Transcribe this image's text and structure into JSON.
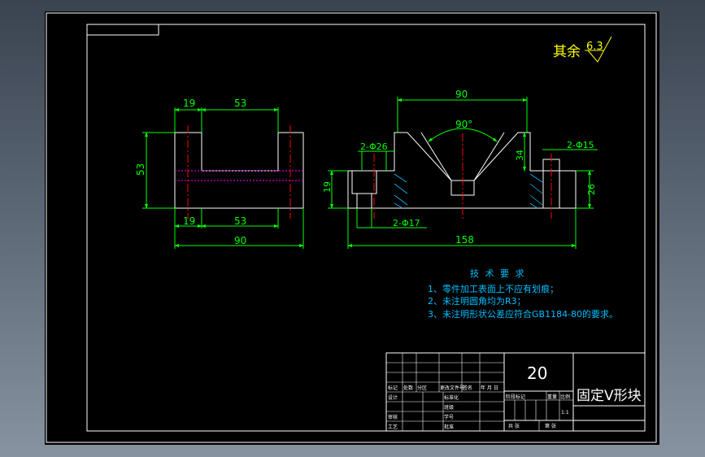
{
  "roughness": {
    "label": "其余",
    "value": "6.3"
  },
  "front_view": {
    "dim_top_left": "19",
    "dim_top_right": "53",
    "dim_height": "53",
    "dim_bottom_left": "19",
    "dim_bottom_right": "53",
    "dim_total": "90"
  },
  "side_view": {
    "dim_top": "90",
    "dim_angle": "90°",
    "dim_hole_left": "2-Φ26",
    "dim_hole_right": "2-Φ15",
    "dim_depth": "34",
    "dim_height_left": "19",
    "dim_height_right": "26",
    "dim_hole_bottom": "2-Φ17",
    "dim_total": "158"
  },
  "tech_requirements": {
    "title": "技 术 要 求",
    "items": [
      "1、零件加工表面上不应有划痕；",
      "2、未注明圆角均为R3；",
      "3、未注明形状公差应符合GB1184-80的要求。"
    ]
  },
  "title_block": {
    "drawing_no": "20",
    "part_name": "固定V形块",
    "scale": "1:1",
    "rows": {
      "mark": "标记",
      "count": "处数",
      "zone": "分区",
      "doc": "更改文件号",
      "sign": "签名",
      "date": "年 月 日",
      "design": "设计",
      "review": "审核",
      "process": "工艺",
      "standard": "标准化",
      "approve": "批准",
      "class": "班级",
      "student_no": "学号",
      "stage": "阶段标记",
      "weight": "重量",
      "ratio": "比例",
      "sheet_total": "共 张",
      "sheet_no": "第 张"
    }
  }
}
